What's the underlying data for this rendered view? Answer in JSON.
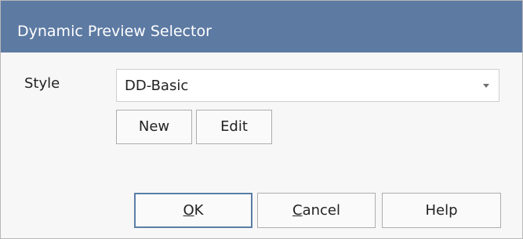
{
  "window": {
    "title": "Dynamic Preview Selector"
  },
  "form": {
    "style_label": "Style",
    "style_value": "DD-Basic"
  },
  "buttons": {
    "new_label": "New",
    "edit_label": "Edit",
    "ok_mnemonic": "O",
    "ok_rest": "K",
    "cancel_mnemonic": "C",
    "cancel_rest": "ancel",
    "help_label": "Help"
  },
  "colors": {
    "titlebar": "#5d7aa3",
    "default_button_border": "#5b7da7"
  },
  "icons": {
    "style_dropdown": "chevron-down-icon"
  }
}
